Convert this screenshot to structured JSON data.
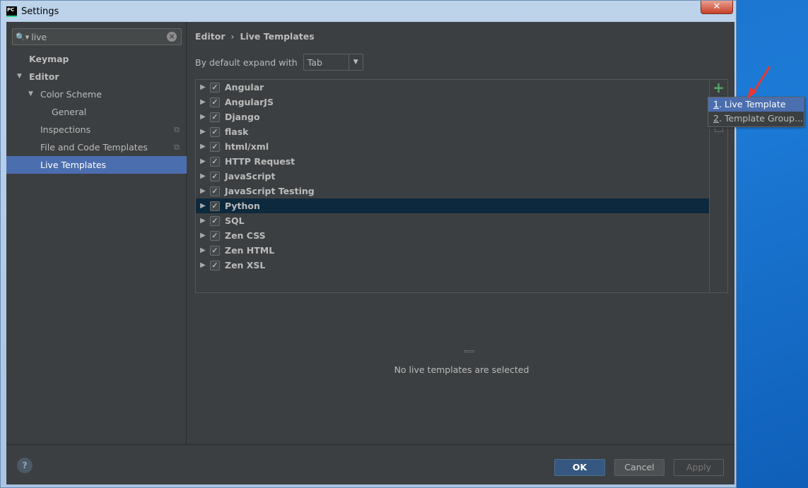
{
  "window": {
    "title": "Settings",
    "app_icon": "PC"
  },
  "search": {
    "value": "live"
  },
  "sidebar": {
    "items": [
      {
        "label": "Keymap",
        "level": 0,
        "bold": true
      },
      {
        "label": "Editor",
        "level": 0,
        "bold": true,
        "expanded": true
      },
      {
        "label": "Color Scheme",
        "level": 1,
        "expanded": true
      },
      {
        "label": "General",
        "level": 2
      },
      {
        "label": "Inspections",
        "level": 1,
        "copy_icon": true
      },
      {
        "label": "File and Code Templates",
        "level": 1,
        "copy_icon": true
      },
      {
        "label": "Live Templates",
        "level": 1,
        "selected": true
      }
    ]
  },
  "breadcrumb": {
    "parent": "Editor",
    "separator": "›",
    "current": "Live Templates"
  },
  "expand": {
    "label": "By default expand with",
    "value": "Tab"
  },
  "templates": [
    {
      "name": "Angular",
      "checked": true
    },
    {
      "name": "AngularJS",
      "checked": true
    },
    {
      "name": "Django",
      "checked": true
    },
    {
      "name": "flask",
      "checked": true
    },
    {
      "name": "html/xml",
      "checked": true
    },
    {
      "name": "HTTP Request",
      "checked": true
    },
    {
      "name": "JavaScript",
      "checked": true
    },
    {
      "name": "JavaScript Testing",
      "checked": true
    },
    {
      "name": "Python",
      "checked": true,
      "selected": true
    },
    {
      "name": "SQL",
      "checked": true
    },
    {
      "name": "Zen CSS",
      "checked": true
    },
    {
      "name": "Zen HTML",
      "checked": true
    },
    {
      "name": "Zen XSL",
      "checked": true
    }
  ],
  "empty_text": "No live templates are selected",
  "popup": {
    "items": [
      {
        "mnemonic": "1",
        "label": ". Live Template",
        "selected": true
      },
      {
        "mnemonic": "2",
        "label": ". Template Group..."
      }
    ]
  },
  "footer": {
    "ok": "OK",
    "cancel": "Cancel",
    "apply": "Apply",
    "help": "?"
  },
  "colors": {
    "accent": "#4b6eaf",
    "selected_row": "#0d293e",
    "add": "#59a869",
    "annotation_arrow": "#e8392f"
  }
}
